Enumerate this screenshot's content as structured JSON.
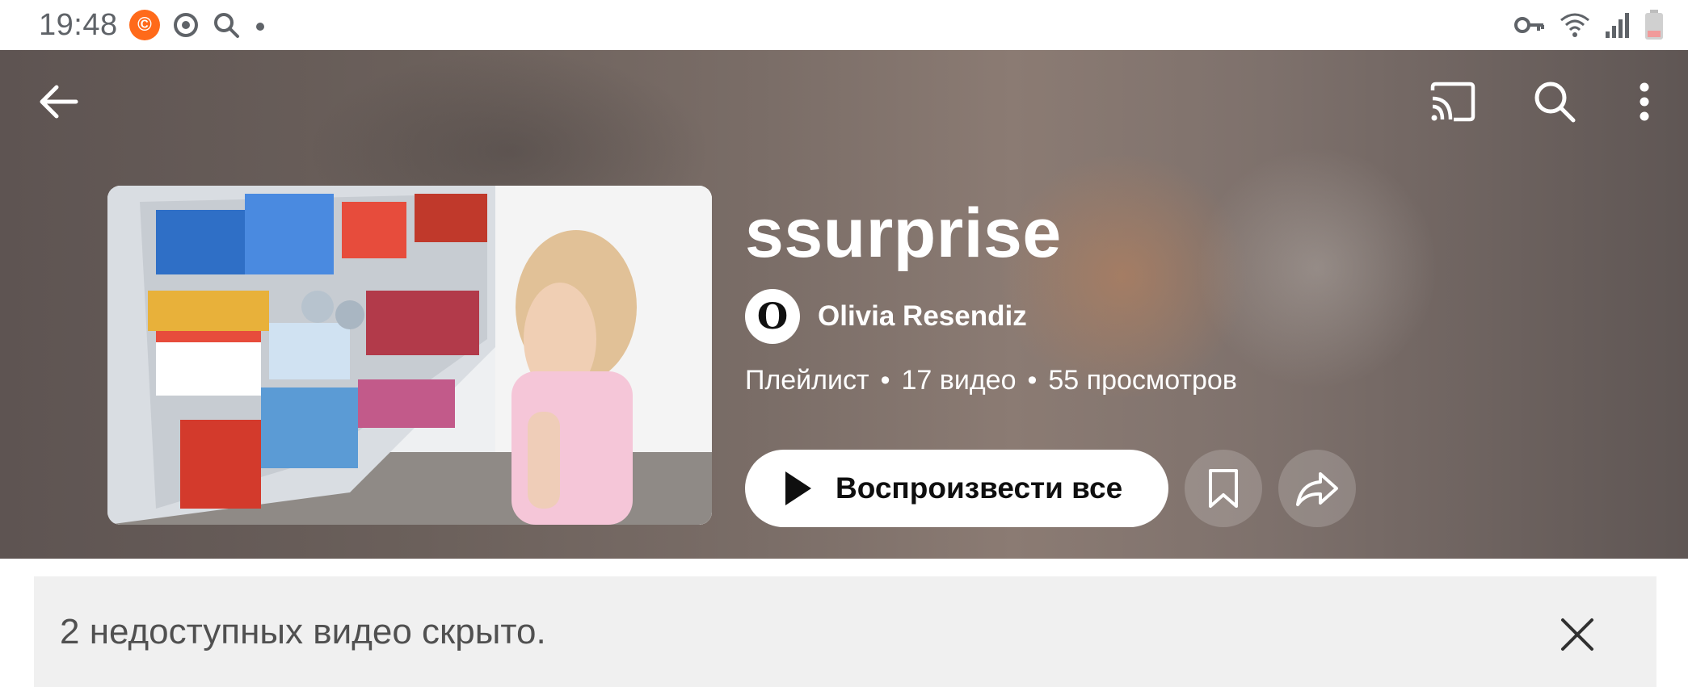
{
  "status_bar": {
    "time": "19:48",
    "left_icons": [
      "app-notification-icon",
      "focus-icon",
      "search-icon",
      "dot-icon"
    ],
    "right_icons": [
      "vpn-key-icon",
      "wifi-icon",
      "signal-icon",
      "battery-icon"
    ]
  },
  "toolbar": {
    "icons": [
      "back-arrow-icon",
      "cast-icon",
      "search-icon",
      "more-vert-icon"
    ]
  },
  "playlist": {
    "title": "ssurprise",
    "author_initial": "O",
    "author_name": "Olivia Resendiz",
    "meta_type": "Плейлист",
    "meta_videos": "17 видео",
    "meta_views": "55 просмотров",
    "play_all_label": "Воспроизвести все",
    "actions": [
      "bookmark-icon",
      "share-icon"
    ]
  },
  "notice": {
    "text": "2 недоступных видео скрыто.",
    "close_icon": "close-icon"
  },
  "colors": {
    "header_bg": "#6e625d",
    "notice_bg": "#f0f0f0",
    "app_badge": "#ff6a1a"
  }
}
